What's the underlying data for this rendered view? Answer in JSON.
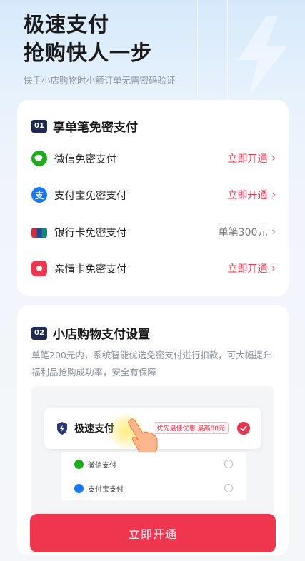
{
  "header": {
    "title_line1": "极速支付",
    "title_line2": "抢购快人一步",
    "subtitle": "快手小店购物时小额订单无需密码验证"
  },
  "section1": {
    "badge": "01",
    "title": "享单笔免密支付",
    "items": [
      {
        "name": "微信免密支付",
        "action": "立即开通",
        "icon": "wechat-pay-icon",
        "color": "#1aad19"
      },
      {
        "name": "支付宝免密支付",
        "action": "立即开通",
        "icon": "alipay-icon",
        "color": "#1677ff"
      },
      {
        "name": "银行卡免密支付",
        "action": "单笔300元",
        "icon": "unionpay-card-icon",
        "color": "#d62b3b"
      },
      {
        "name": "亲情卡免密支付",
        "action": "立即开通",
        "icon": "family-card-icon",
        "color": "#f0364f"
      }
    ]
  },
  "section2": {
    "badge": "02",
    "title": "小店购物支付设置",
    "description": "单笔200元内，系统智能优选免密支付进行扣款，可大幅提升福利品抢购成功率，安全有保障",
    "preview": {
      "main_title": "极速支付",
      "tag": "优先最佳优惠 最高88元",
      "options": [
        "微信支付",
        "支付宝支付"
      ]
    }
  },
  "button": {
    "label": "立即开通"
  },
  "colors": {
    "accent": "#f0364f",
    "navy": "#1e2a52"
  }
}
